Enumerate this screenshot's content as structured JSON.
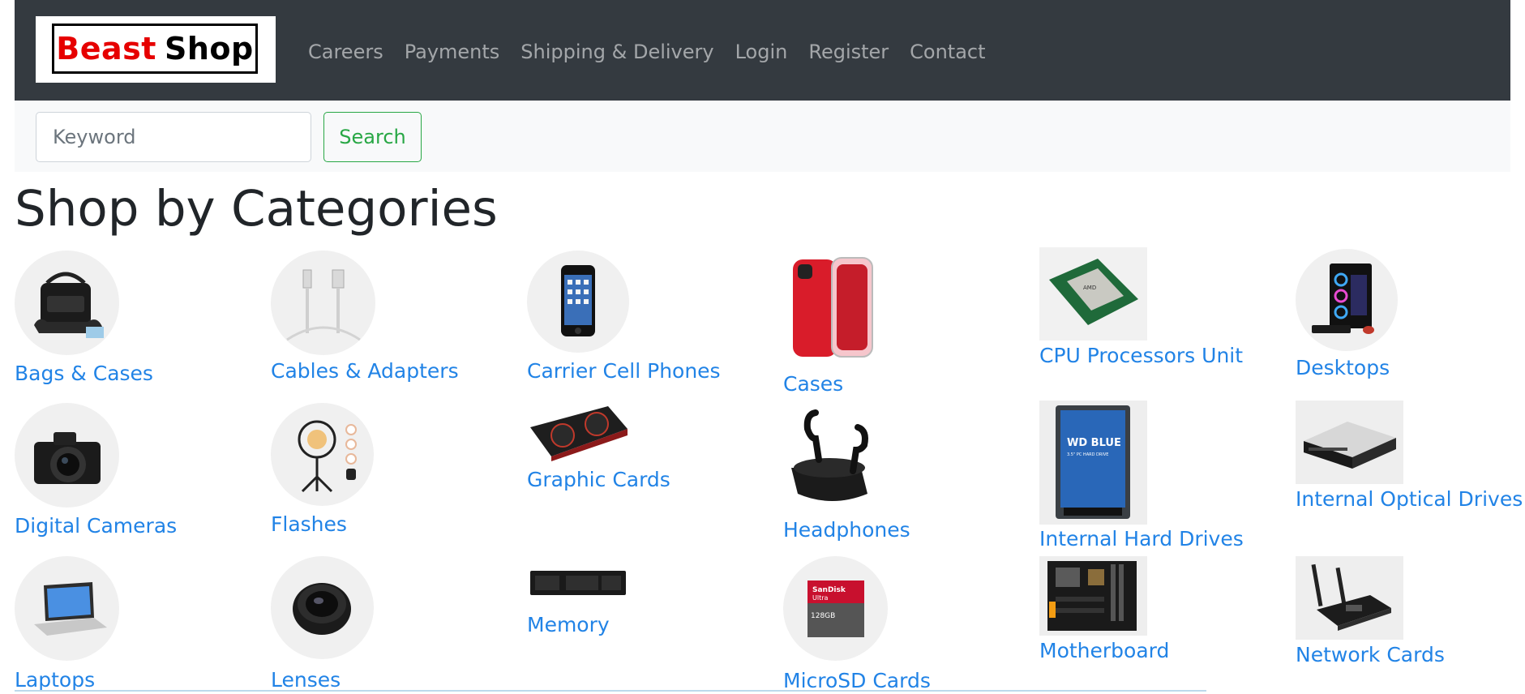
{
  "brand": {
    "word1": "Beast",
    "word2": "Shop"
  },
  "nav": {
    "links": [
      "Careers",
      "Payments",
      "Shipping & Delivery",
      "Login",
      "Register",
      "Contact"
    ]
  },
  "search": {
    "placeholder": "Keyword",
    "value": "",
    "button_label": "Search"
  },
  "main": {
    "title": "Shop by Categories"
  },
  "categories": [
    {
      "label": "Bags & Cases",
      "icon": "camera-bag-icon"
    },
    {
      "label": "Cables & Adapters",
      "icon": "usb-cable-icon"
    },
    {
      "label": "Carrier Cell Phones",
      "icon": "smartphone-icon"
    },
    {
      "label": "Cases",
      "icon": "phone-case-icon"
    },
    {
      "label": "CPU Processors Unit",
      "icon": "cpu-chip-icon"
    },
    {
      "label": "Desktops",
      "icon": "desktop-tower-icon"
    },
    {
      "label": "Digital Cameras",
      "icon": "camera-icon"
    },
    {
      "label": "Flashes",
      "icon": "ring-light-icon"
    },
    {
      "label": "Graphic Cards",
      "icon": "graphics-card-icon"
    },
    {
      "label": "Headphones",
      "icon": "earbuds-icon"
    },
    {
      "label": "Internal Hard Drives",
      "icon": "hard-drive-icon"
    },
    {
      "label": "Internal Optical Drives",
      "icon": "optical-drive-icon"
    },
    {
      "label": "Laptops",
      "icon": "laptop-icon"
    },
    {
      "label": "Lenses",
      "icon": "lens-icon"
    },
    {
      "label": "Memory",
      "icon": "ssd-memory-icon"
    },
    {
      "label": "MicroSD Cards",
      "icon": "microsd-card-icon"
    },
    {
      "label": "Motherboard",
      "icon": "motherboard-icon"
    },
    {
      "label": "Network Cards",
      "icon": "network-card-icon"
    }
  ],
  "microsd_text": {
    "brand": "SanDisk",
    "line": "Ultra",
    "capacity": "128GB"
  },
  "hdd_text": {
    "brand": "WD BLUE",
    "sub": "3.5\" PC HARD DRIVE"
  },
  "colors": {
    "navbar": "#343a40",
    "search_bar": "#f8f9fa",
    "link": "#2183e6",
    "search_button": "#28a745",
    "brand_red": "#e60000"
  }
}
